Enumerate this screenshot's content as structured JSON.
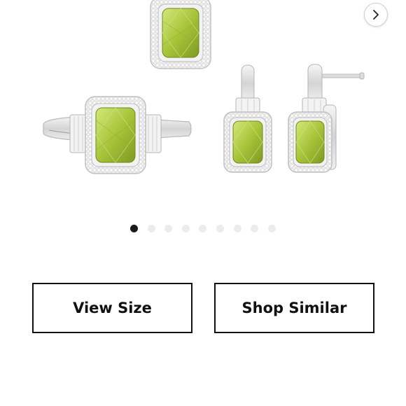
{
  "gallery": {
    "image_name": "peridot-halo-ring-and-earrings-set",
    "next_icon": "chevron-right-icon",
    "slide_count": 9,
    "active_index": 0,
    "gem_color": "#a8c43a",
    "metal_color": "#e2e2e2"
  },
  "actions": {
    "view_size_label": "View Size",
    "shop_similar_label": "Shop Similar"
  }
}
